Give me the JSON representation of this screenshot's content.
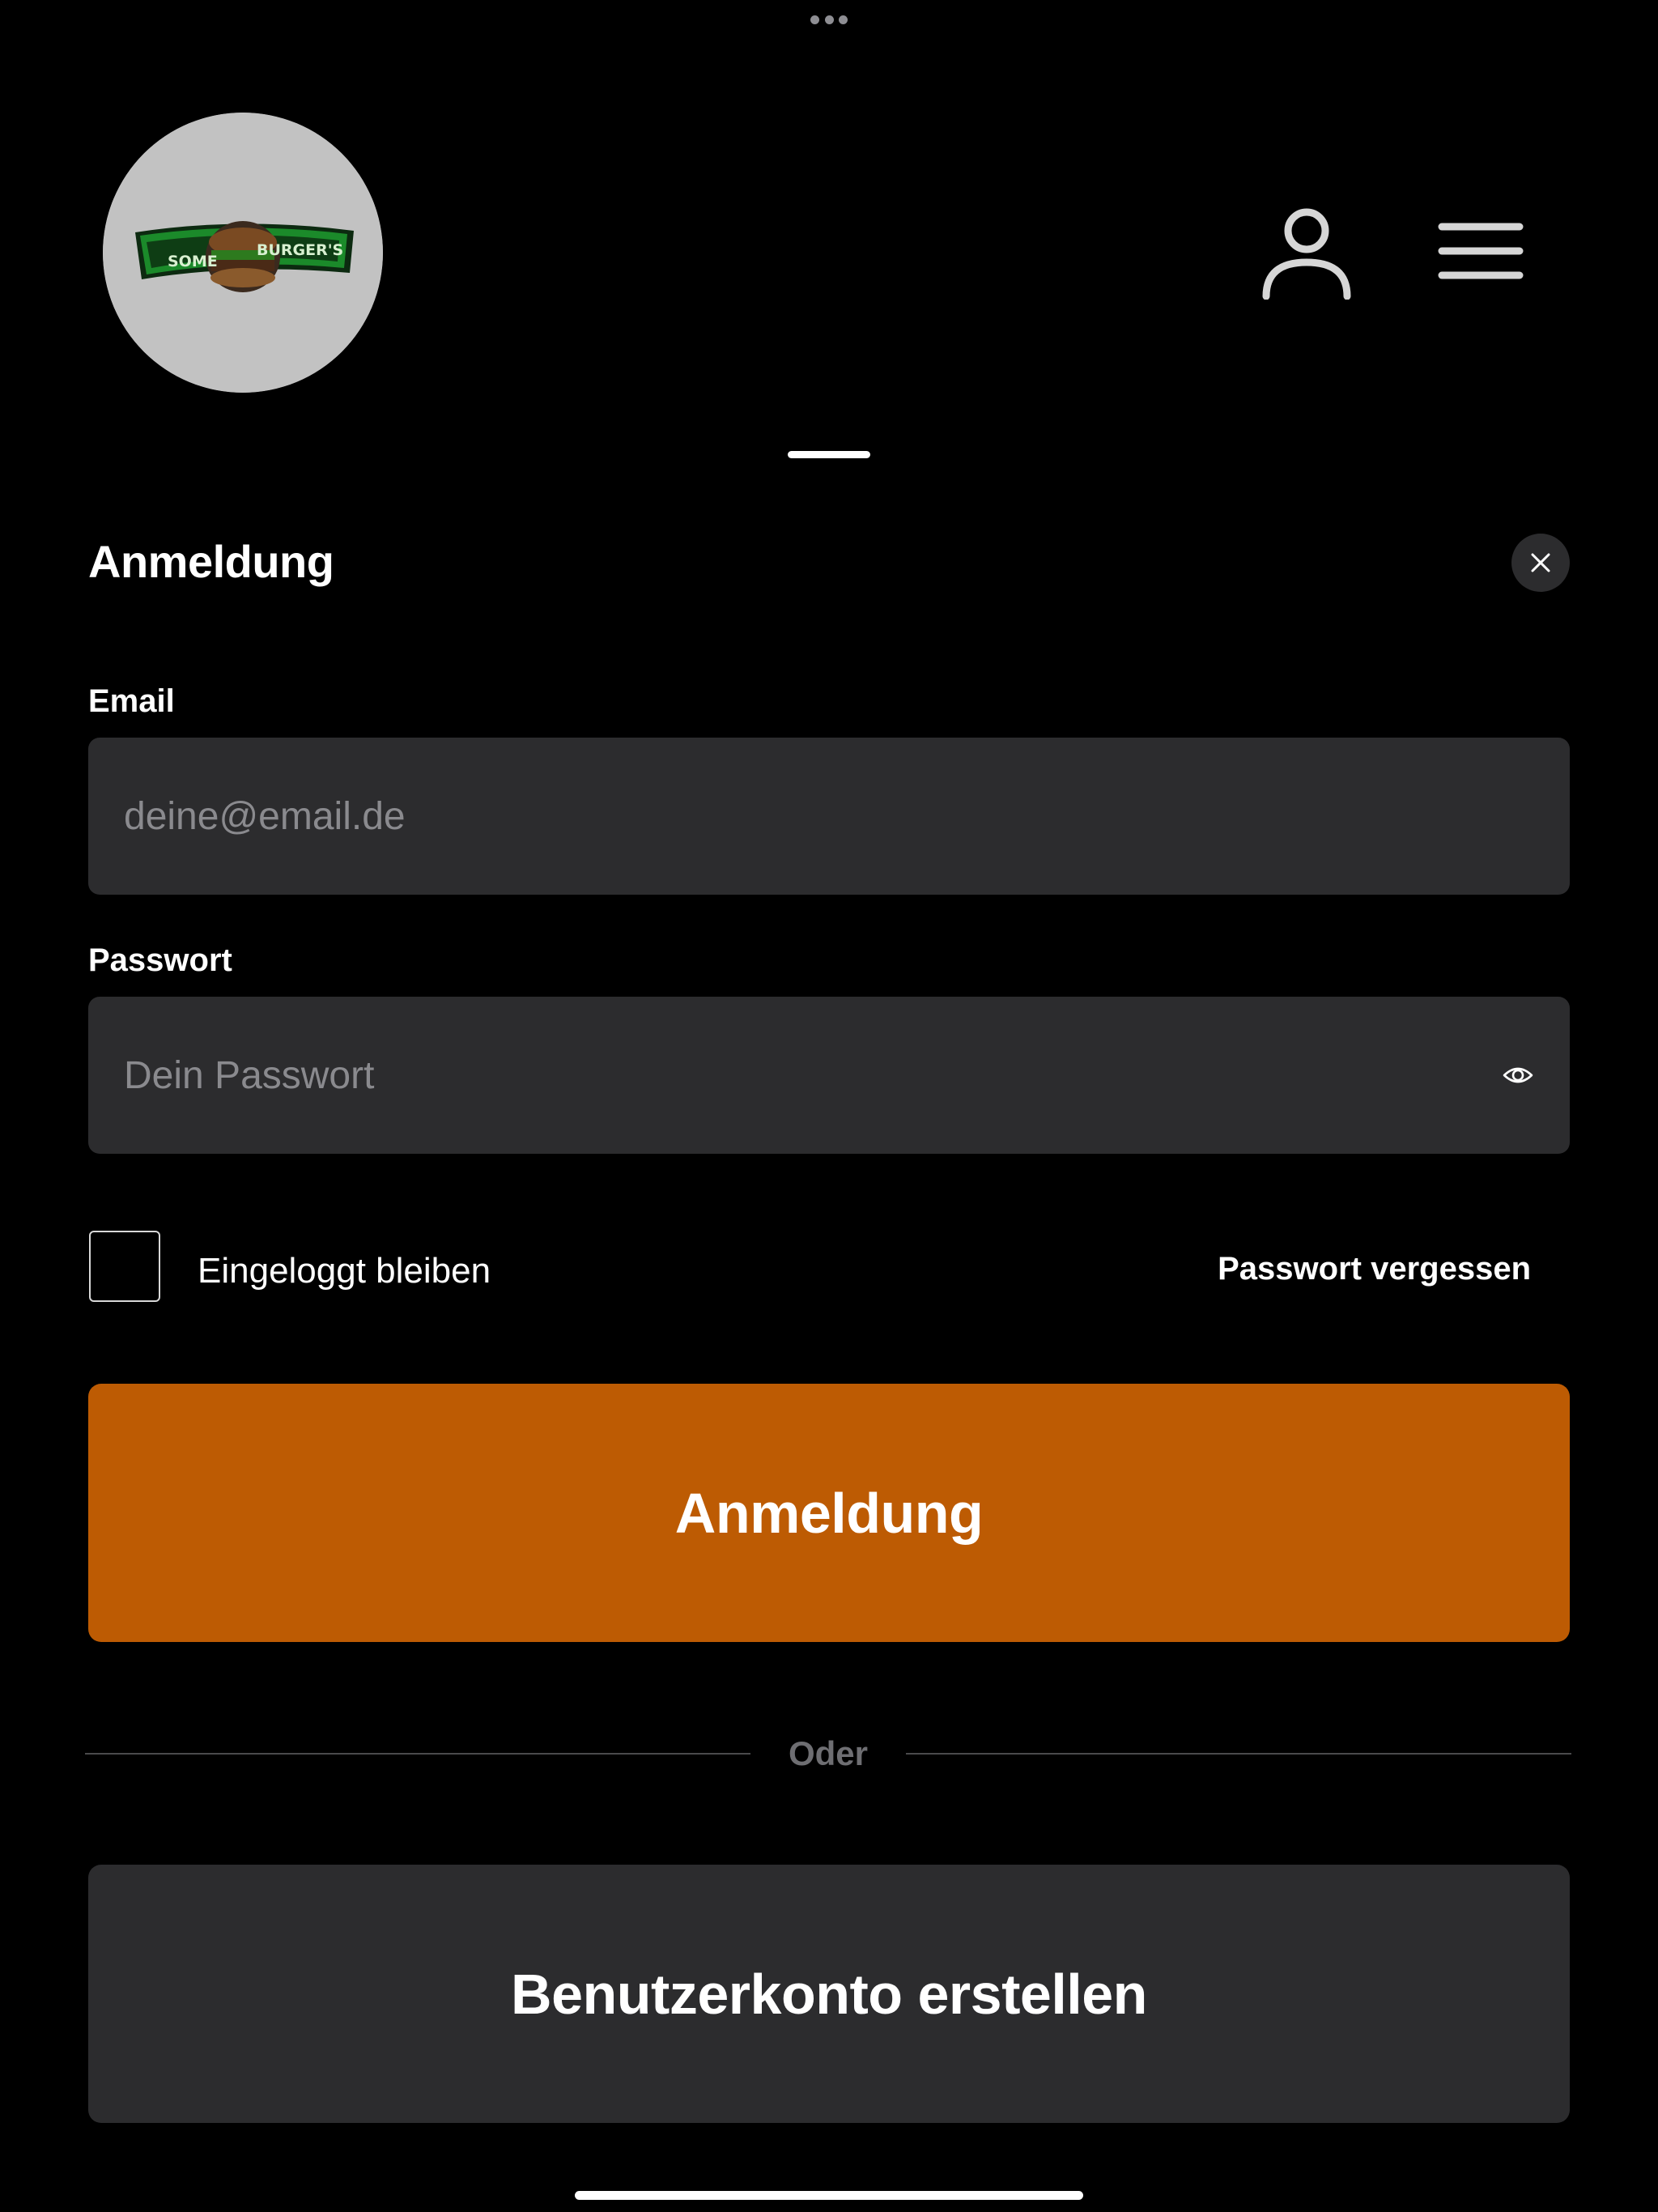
{
  "logo": {
    "text_left": "SOME",
    "text_right": "BURGER'S",
    "bg_color": "#c2c2c2",
    "banner_color": "#1b8a2a"
  },
  "header": {
    "user_icon": "user-icon",
    "menu_icon": "hamburger-menu-icon"
  },
  "sheet": {
    "title": "Anmeldung",
    "close_icon": "close-icon"
  },
  "form": {
    "email_label": "Email",
    "email_placeholder": "deine@email.de",
    "email_value": "",
    "password_label": "Passwort",
    "password_placeholder": "Dein Passwort",
    "password_value": "",
    "show_password_icon": "eye-icon",
    "remember_label": "Eingeloggt bleiben",
    "remember_checked": false,
    "forgot_label": "Passwort vergessen",
    "login_button": "Anmeldung",
    "divider_text": "Oder",
    "create_account_button": "Benutzerkonto erstellen"
  },
  "colors": {
    "background": "#000000",
    "surface": "#2c2c2e",
    "accent": "#bd5b03",
    "placeholder": "#8a8a8e",
    "muted_text": "#6e6e72"
  }
}
